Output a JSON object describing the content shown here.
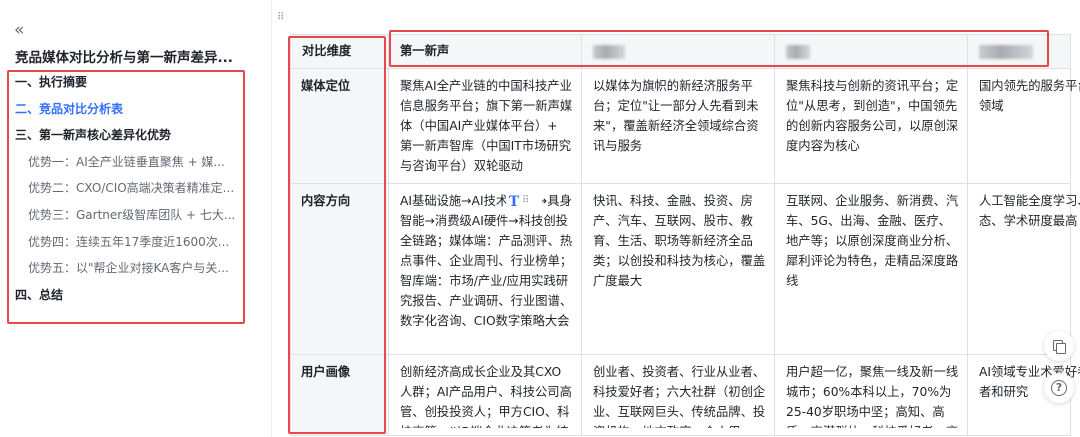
{
  "sidebar": {
    "collapse_glyph": "«",
    "doc_title": "竞品媒体对比分析与第一新声差异...",
    "toc": [
      {
        "label": "一、执行摘要",
        "level": 1,
        "active": false
      },
      {
        "label": "二、竞品对比分析表",
        "level": 1,
        "active": true
      },
      {
        "label": "三、第一新声核心差异化优势",
        "level": 1,
        "active": false
      },
      {
        "label": "优势一：AI全产业链垂直聚焦 + 媒...",
        "level": 2,
        "active": false
      },
      {
        "label": "优势二：CXO/CIO高端决策者精准定...",
        "level": 2,
        "active": false
      },
      {
        "label": "优势三：Gartner级智库团队 + 七大...",
        "level": 2,
        "active": false
      },
      {
        "label": "优势四：连续五年17季度近1600次...",
        "level": 2,
        "active": false
      },
      {
        "label": "优势五：以\"帮企业对接KA客户与关...",
        "level": 2,
        "active": false
      },
      {
        "label": "四、总结",
        "level": 1,
        "active": false
      }
    ]
  },
  "main": {
    "top_partial_text": "· · · · ·  · · · · · · · · · · · · · · · ·",
    "table": {
      "header": [
        "对比维度",
        "第一新声"
      ],
      "rows": [
        {
          "dimension": "媒体定位",
          "cells": [
            "聚焦AI全产业链的中国科技产业信息服务平台；旗下第一新声媒体（中国AI产业媒体平台）+ 第一新声智库（中国IT市场研究与咨询平台）双轮驱动",
            "以媒体为旗帜的新经济服务平台；定位\"让一部分人先看到未来\"，覆盖新经济全领域综合资讯与服务",
            "聚焦科技与创新的资讯平台；定位\"从思考，到创造\"，中国领先的创新内容服务公司，以原创深度内容为核心",
            "国内领先的服务平台；人工智能的直领域"
          ]
        },
        {
          "dimension": "内容方向",
          "cells": [
            "AI基础设施→AI技术/产品→具身智能→消费级AI硬件→科技创投全链路；媒体端：产品测评、热点事件、企业周刊、行业榜单；智库端：市场/产业/应用实践研究报告、产业调研、行业图谱、数字化咨询、CIO数字策略大会",
            "快讯、科技、金融、投资、房产、汽车、互联网、股市、教育、生活、职场等新经济全品类；以创投和科技为核心，覆盖广度最大",
            "互联网、企业服务、新消费、汽车、5G、出海、金融、医疗、地产等；以原创深度商业分析、犀利评论为特色，走精品深度路线",
            "人工智能全度学习、计器人、神经态、学术研度最高"
          ]
        },
        {
          "dimension": "用户画像",
          "cells": [
            "创新经济高成长企业及其CXO人群；AI产品用户、科技公司高管、创投投资人；甲方CIO、科技高管；以B端企业决策者为核",
            "创业者、投资者、行业从业者、科技爱好者；六大社群（初创企业、互联网巨头、传统品牌、投资机构、地方政府、个人用",
            "用户超一亿，聚焦一线及新一线城市；60%本科以上，70%为25-40岁职场中坚；高知、高质、高潜群体；科技爱好者、商",
            "AI领域专业术爱好者；产业需求方业者和研究"
          ]
        }
      ]
    },
    "cell_tool_glyph": "T",
    "handle_dots": "⠿"
  },
  "fabs": {
    "help_glyph": "?"
  },
  "colors": {
    "accent": "#3370ff",
    "annotation_red": "#e8474c",
    "table_grid_icon": "#3aa55a"
  }
}
